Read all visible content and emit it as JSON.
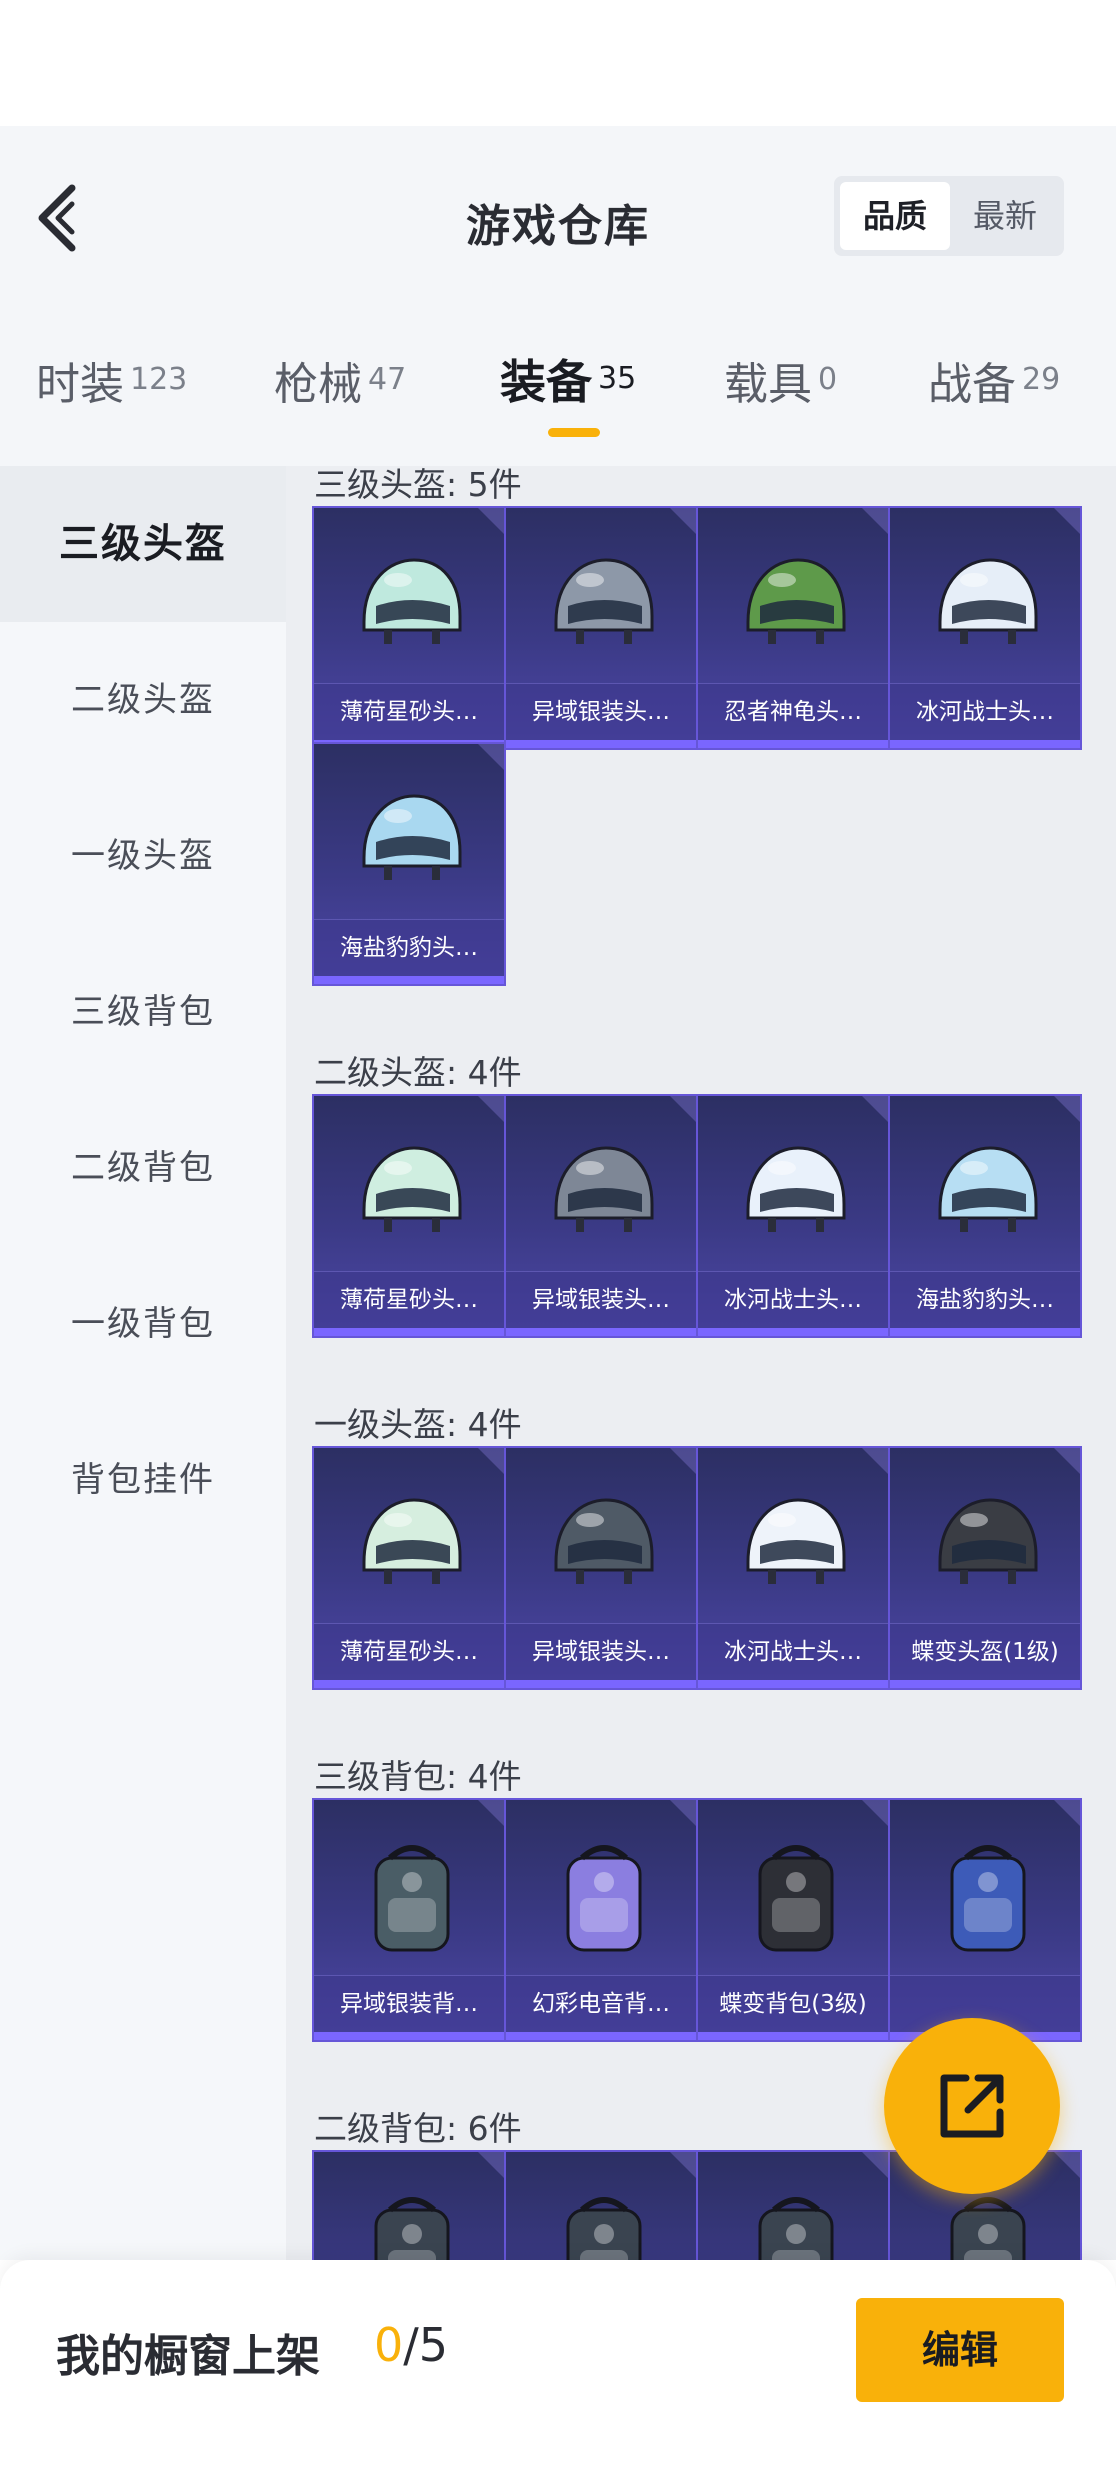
{
  "header": {
    "title": "游戏仓库",
    "back_icon": "chevron-left-icon",
    "sort": {
      "active": "品质",
      "inactive": "最新"
    }
  },
  "tabs": [
    {
      "label": "时装",
      "count": "123",
      "active": false
    },
    {
      "label": "枪械",
      "count": "47",
      "active": false
    },
    {
      "label": "装备",
      "count": "35",
      "active": true
    },
    {
      "label": "载具",
      "count": "0",
      "active": false
    },
    {
      "label": "战备",
      "count": "29",
      "active": false
    }
  ],
  "sidebar": {
    "items": [
      {
        "label": "三级头盔",
        "active": true
      },
      {
        "label": "二级头盔",
        "active": false
      },
      {
        "label": "一级头盔",
        "active": false
      },
      {
        "label": "三级背包",
        "active": false
      },
      {
        "label": "二级背包",
        "active": false
      },
      {
        "label": "一级背包",
        "active": false
      },
      {
        "label": "背包挂件",
        "active": false
      }
    ]
  },
  "sections": [
    {
      "title": "三级头盔: 5件",
      "items": [
        {
          "name": "薄荷星砂头…",
          "icon": "helmet-icon",
          "color": "#bfe9de"
        },
        {
          "name": "异域银装头…",
          "icon": "helmet-icon",
          "color": "#8d98a8"
        },
        {
          "name": "忍者神龟头…",
          "icon": "helmet-icon",
          "color": "#5e9a4a"
        },
        {
          "name": "冰河战士头…",
          "icon": "helmet-icon",
          "color": "#e6eef8"
        },
        {
          "name": "海盐豹豹头…",
          "icon": "helmet-icon",
          "color": "#a9d8f0"
        }
      ]
    },
    {
      "title": "二级头盔: 4件",
      "items": [
        {
          "name": "薄荷星砂头…",
          "icon": "helmet-icon",
          "color": "#cfeee0"
        },
        {
          "name": "异域银装头…",
          "icon": "helmet-icon",
          "color": "#7e8796"
        },
        {
          "name": "冰河战士头…",
          "icon": "helmet-icon",
          "color": "#e9f1fb"
        },
        {
          "name": "海盐豹豹头…",
          "icon": "helmet-icon",
          "color": "#b7def3"
        }
      ]
    },
    {
      "title": "一级头盔: 4件",
      "items": [
        {
          "name": "薄荷星砂头…",
          "icon": "helmet-icon",
          "color": "#d6eedf"
        },
        {
          "name": "异域银装头…",
          "icon": "helmet-icon",
          "color": "#4f5a66"
        },
        {
          "name": "冰河战士头…",
          "icon": "helmet-icon",
          "color": "#eef3fa"
        },
        {
          "name": "蝶变头盔(1级)",
          "icon": "helmet-icon",
          "color": "#3a3d44"
        }
      ]
    },
    {
      "title": "三级背包: 4件",
      "items": [
        {
          "name": "异域银装背…",
          "icon": "backpack-icon",
          "color": "#4a5d66"
        },
        {
          "name": "幻彩电音背…",
          "icon": "backpack-icon",
          "color": "#8b7ee0"
        },
        {
          "name": "蝶变背包(3级)",
          "icon": "backpack-icon",
          "color": "#2d2f36"
        },
        {
          "name": "",
          "icon": "backpack-icon",
          "color": "#3d5bb8"
        }
      ]
    },
    {
      "title": "二级背包: 6件",
      "items": [
        {
          "name": "",
          "icon": "backpack-icon",
          "color": "#3a4450"
        },
        {
          "name": "",
          "icon": "backpack-icon",
          "color": "#3a4450"
        },
        {
          "name": "",
          "icon": "backpack-icon",
          "color": "#3a4450"
        },
        {
          "name": "",
          "icon": "backpack-icon",
          "color": "#3a4450"
        }
      ]
    }
  ],
  "footer": {
    "label": "我的橱窗上架",
    "current": "0",
    "total": "/5",
    "edit_label": "编辑"
  },
  "share_icon": "share-external-icon",
  "colors": {
    "accent": "#f9b10a",
    "card_border": "#6656d8"
  }
}
